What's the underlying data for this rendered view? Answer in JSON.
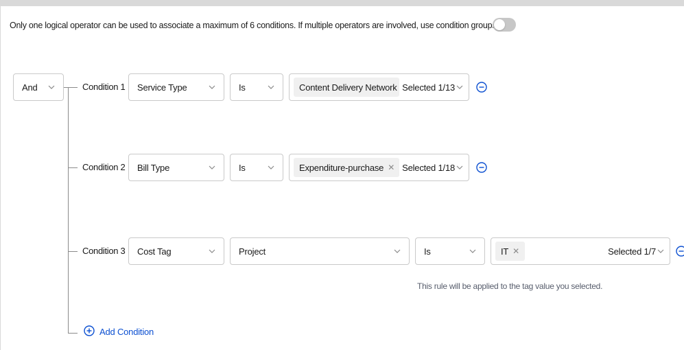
{
  "notice": "Only one logical operator can be used to associate a maximum of 6 conditions. If multiple operators are involved, use condition groups.",
  "condition_groups_toggle": false,
  "logic_operator": "And",
  "conditions": [
    {
      "label": "Condition 1",
      "field": "Service Type",
      "operator": "Is",
      "value_tag": "Content Delivery Network (CDN)",
      "selected": "Selected 1/13"
    },
    {
      "label": "Condition 2",
      "field": "Bill Type",
      "operator": "Is",
      "value_tag": "Expenditure-purchase",
      "selected": "Selected 1/18"
    },
    {
      "label": "Condition 3",
      "field": "Cost Tag",
      "tag_key": "Project",
      "operator": "Is",
      "value_tag": "IT",
      "selected": "Selected 1/7",
      "hint": "This rule will be applied to the tag value you selected."
    }
  ],
  "add_condition_label": "Add Condition",
  "colors": {
    "accent": "#0b4fd1",
    "border": "#c9c9c9",
    "tag_bg": "#f0f0f0"
  }
}
